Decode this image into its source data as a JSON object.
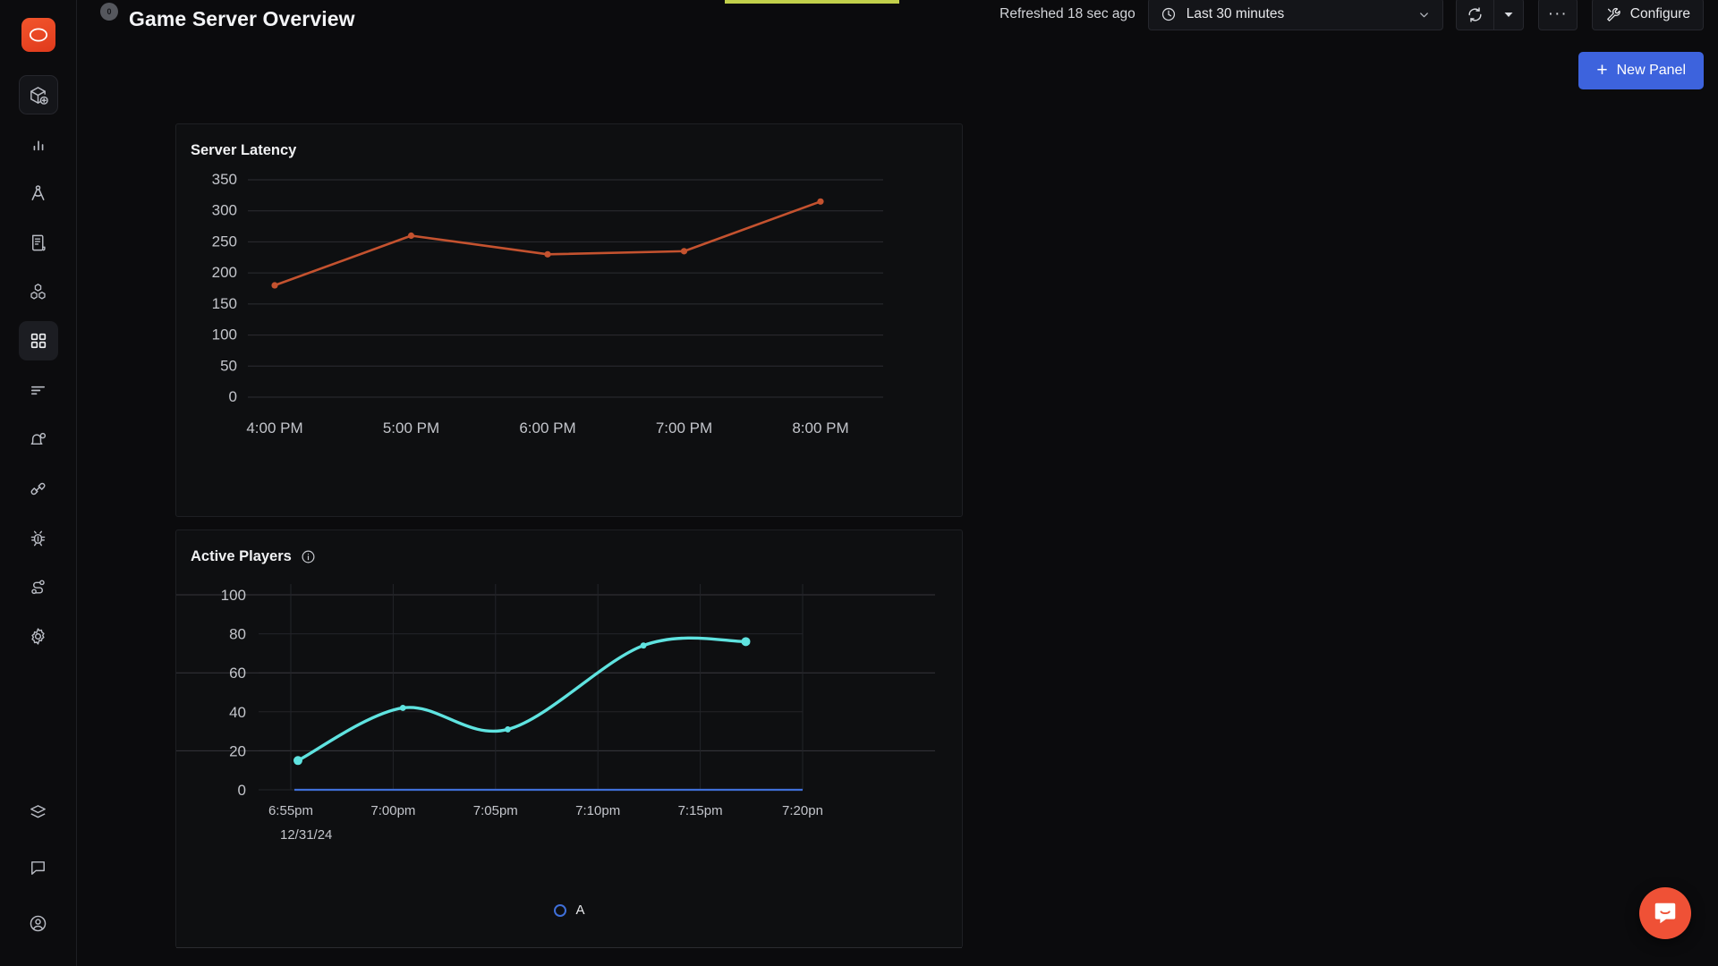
{
  "app": {
    "logo_icon": "eye-logo-icon",
    "logo_color": "#ef4a22",
    "background": "#0b0b0d"
  },
  "topbar": {
    "title": "Game Server Overview",
    "title_badge": "0",
    "refreshed_text": "Refreshed 18 sec ago",
    "time_range": {
      "icon": "clock-icon",
      "label": "Last 30 minutes",
      "caret": "chevron-down-icon"
    },
    "refresh_button_icon": "refresh-icon",
    "refresh_caret_icon": "caret-down-icon",
    "more_button_label": "···",
    "configure_button": {
      "icon": "wrench-icon",
      "label": "Configure"
    },
    "new_panel_button": {
      "plus": "+",
      "label": "New Panel",
      "color": "#3d63dd"
    },
    "progress_color": "#c2d04b"
  },
  "sidebar": {
    "items": [
      {
        "name": "add-package-icon",
        "active": false,
        "boxed": true
      },
      {
        "name": "bar-chart-icon",
        "active": false,
        "boxed": false
      },
      {
        "name": "compass-icon",
        "active": false,
        "boxed": false
      },
      {
        "name": "scroll-document-icon",
        "active": false,
        "boxed": false
      },
      {
        "name": "cubes-icon",
        "active": false,
        "boxed": false
      },
      {
        "name": "dashboard-grid-icon",
        "active": true,
        "boxed": false
      },
      {
        "name": "list-lines-icon",
        "active": false,
        "boxed": false
      },
      {
        "name": "bell-alert-icon",
        "active": false,
        "boxed": false
      },
      {
        "name": "plug-connect-icon",
        "active": false,
        "boxed": false
      },
      {
        "name": "bug-icon",
        "active": false,
        "boxed": false
      },
      {
        "name": "flow-nodes-icon",
        "active": false,
        "boxed": false
      },
      {
        "name": "gear-settings-icon",
        "active": false,
        "boxed": false
      }
    ],
    "bottom_items": [
      {
        "name": "layers-icon"
      },
      {
        "name": "chat-bubble-icon"
      },
      {
        "name": "user-account-icon"
      }
    ]
  },
  "panels": [
    {
      "title": "Server Latency",
      "has_info_icon": false
    },
    {
      "title": "Active Players",
      "has_info_icon": true,
      "info_icon": "info-circle-icon"
    }
  ],
  "legend": {
    "marker": "circle-outline-marker",
    "marker_color": "#3f6fd8",
    "label": "A"
  },
  "intercom": {
    "icon": "intercom-chat-icon",
    "color": "#ef5136"
  },
  "chart_data": [
    {
      "type": "line",
      "title": "Server Latency",
      "x": [
        "4:00 PM",
        "5:00 PM",
        "6:00 PM",
        "7:00 PM",
        "8:00 PM"
      ],
      "values": [
        180,
        260,
        230,
        235,
        315
      ],
      "xlabel": "",
      "ylabel": "",
      "ylim": [
        0,
        350
      ],
      "yticks": [
        0,
        50,
        100,
        150,
        200,
        250,
        300,
        350
      ],
      "xtick_labels": [
        "4:00 PM",
        "5:00 PM",
        "6:00 PM",
        "7:00 PM",
        "8:00 PM"
      ],
      "line_color": "#c4522f",
      "grid": true,
      "markers": true,
      "curve": "linear",
      "legend": false
    },
    {
      "type": "line",
      "title": "Active Players",
      "x": [
        "6:55pm",
        "7:00pm",
        "7:05pm",
        "7:10pm",
        "7:15pm",
        "7:20pm"
      ],
      "values": [
        15,
        42,
        31,
        74,
        76
      ],
      "value_positions": [
        "6:55pm",
        "7:00pm",
        "7:05pm",
        "7:13pm",
        "7:19pm"
      ],
      "xlabel": "12/31/24",
      "ylabel": "",
      "ylim": [
        0,
        100
      ],
      "yticks": [
        0,
        20,
        40,
        60,
        80,
        100
      ],
      "xtick_labels": [
        "6:55pm",
        "7:00pm",
        "7:05pm",
        "7:10pm",
        "7:15pm",
        "7:20pn"
      ],
      "date_label": "12/31/24",
      "line_color": "#5fe3e0",
      "baseline_color": "#3f6fd8",
      "grid": true,
      "markers": true,
      "curve": "smooth",
      "legend": true,
      "legend_entries": [
        "A"
      ]
    }
  ]
}
